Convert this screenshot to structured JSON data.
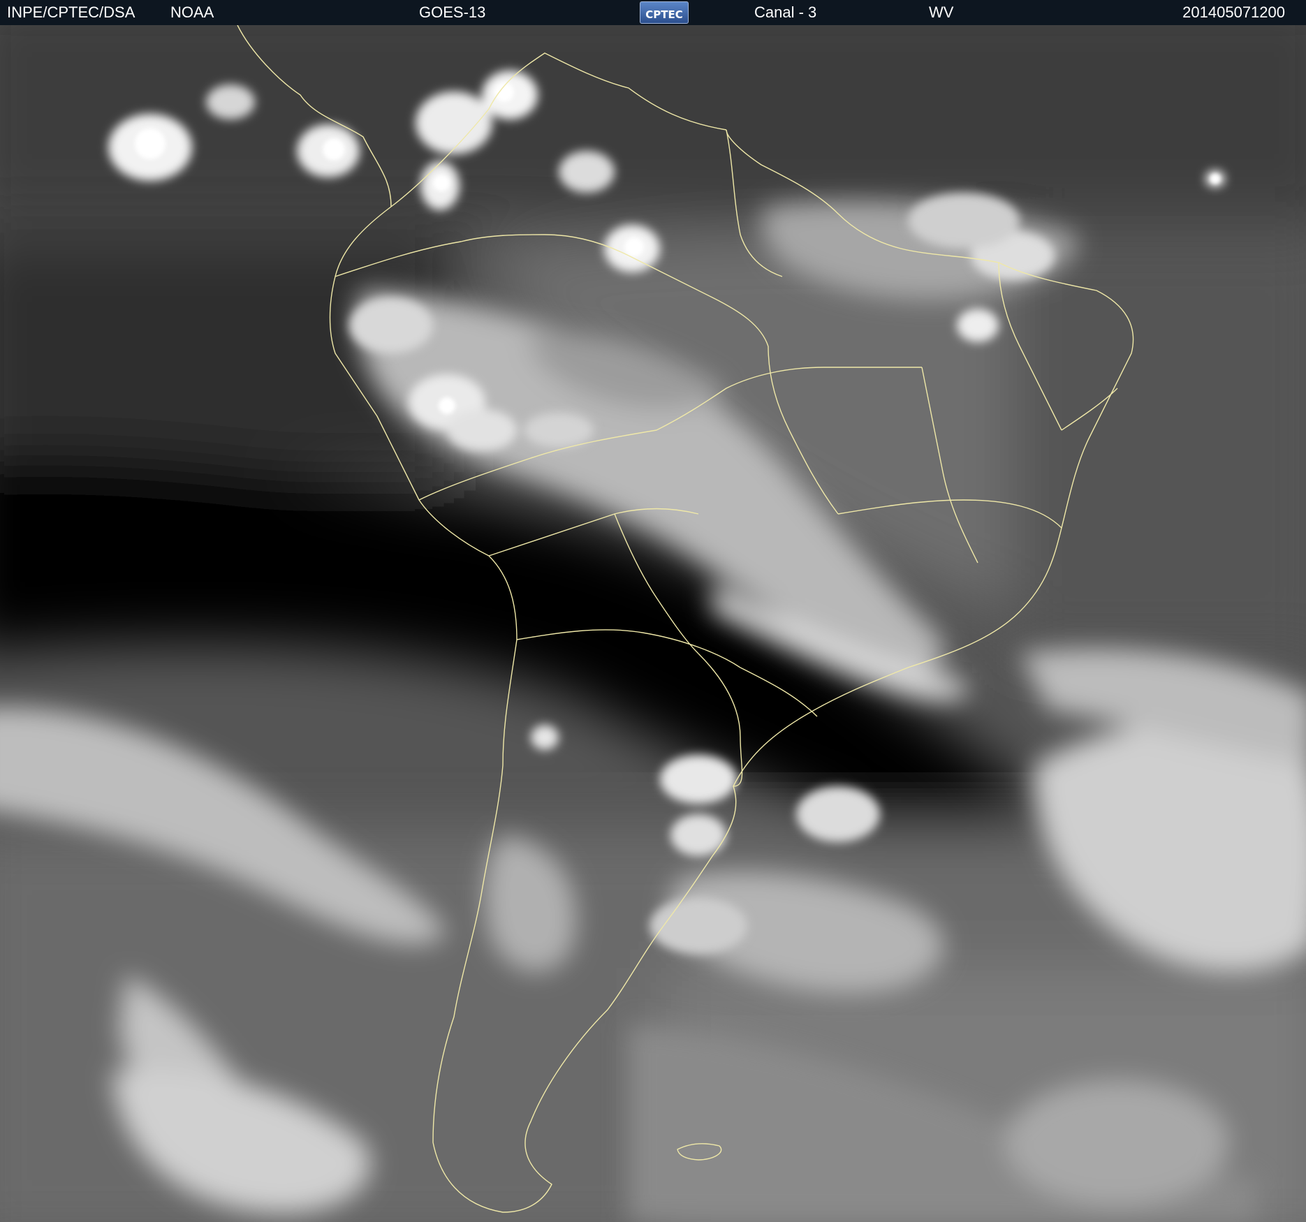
{
  "header": {
    "organization": "INPE/CPTEC/DSA",
    "agency": "NOAA",
    "satellite": "GOES-13",
    "logo_text": "CPTEC",
    "channel": "Canal - 3",
    "band": "WV",
    "timestamp": "201405071200"
  },
  "colors": {
    "header_background": "#0d1620",
    "header_text": "#ffffff",
    "borders": "#efe8a8",
    "logo_background": "#3a5f9e"
  },
  "image": {
    "type": "satellite water-vapor imagery",
    "region": "South America",
    "palette": "grayscale"
  }
}
